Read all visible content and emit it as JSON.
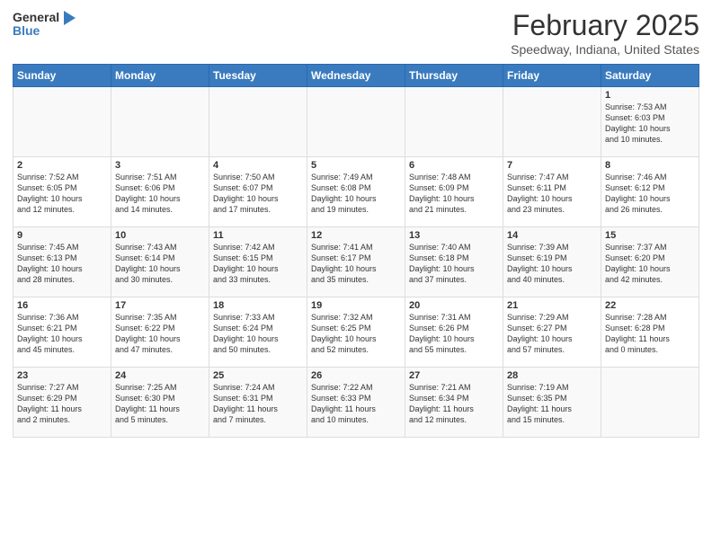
{
  "header": {
    "logo_general": "General",
    "logo_blue": "Blue",
    "title": "February 2025",
    "location": "Speedway, Indiana, United States"
  },
  "weekdays": [
    "Sunday",
    "Monday",
    "Tuesday",
    "Wednesday",
    "Thursday",
    "Friday",
    "Saturday"
  ],
  "weeks": [
    [
      {
        "day": "",
        "info": ""
      },
      {
        "day": "",
        "info": ""
      },
      {
        "day": "",
        "info": ""
      },
      {
        "day": "",
        "info": ""
      },
      {
        "day": "",
        "info": ""
      },
      {
        "day": "",
        "info": ""
      },
      {
        "day": "1",
        "info": "Sunrise: 7:53 AM\nSunset: 6:03 PM\nDaylight: 10 hours\nand 10 minutes."
      }
    ],
    [
      {
        "day": "2",
        "info": "Sunrise: 7:52 AM\nSunset: 6:05 PM\nDaylight: 10 hours\nand 12 minutes."
      },
      {
        "day": "3",
        "info": "Sunrise: 7:51 AM\nSunset: 6:06 PM\nDaylight: 10 hours\nand 14 minutes."
      },
      {
        "day": "4",
        "info": "Sunrise: 7:50 AM\nSunset: 6:07 PM\nDaylight: 10 hours\nand 17 minutes."
      },
      {
        "day": "5",
        "info": "Sunrise: 7:49 AM\nSunset: 6:08 PM\nDaylight: 10 hours\nand 19 minutes."
      },
      {
        "day": "6",
        "info": "Sunrise: 7:48 AM\nSunset: 6:09 PM\nDaylight: 10 hours\nand 21 minutes."
      },
      {
        "day": "7",
        "info": "Sunrise: 7:47 AM\nSunset: 6:11 PM\nDaylight: 10 hours\nand 23 minutes."
      },
      {
        "day": "8",
        "info": "Sunrise: 7:46 AM\nSunset: 6:12 PM\nDaylight: 10 hours\nand 26 minutes."
      }
    ],
    [
      {
        "day": "9",
        "info": "Sunrise: 7:45 AM\nSunset: 6:13 PM\nDaylight: 10 hours\nand 28 minutes."
      },
      {
        "day": "10",
        "info": "Sunrise: 7:43 AM\nSunset: 6:14 PM\nDaylight: 10 hours\nand 30 minutes."
      },
      {
        "day": "11",
        "info": "Sunrise: 7:42 AM\nSunset: 6:15 PM\nDaylight: 10 hours\nand 33 minutes."
      },
      {
        "day": "12",
        "info": "Sunrise: 7:41 AM\nSunset: 6:17 PM\nDaylight: 10 hours\nand 35 minutes."
      },
      {
        "day": "13",
        "info": "Sunrise: 7:40 AM\nSunset: 6:18 PM\nDaylight: 10 hours\nand 37 minutes."
      },
      {
        "day": "14",
        "info": "Sunrise: 7:39 AM\nSunset: 6:19 PM\nDaylight: 10 hours\nand 40 minutes."
      },
      {
        "day": "15",
        "info": "Sunrise: 7:37 AM\nSunset: 6:20 PM\nDaylight: 10 hours\nand 42 minutes."
      }
    ],
    [
      {
        "day": "16",
        "info": "Sunrise: 7:36 AM\nSunset: 6:21 PM\nDaylight: 10 hours\nand 45 minutes."
      },
      {
        "day": "17",
        "info": "Sunrise: 7:35 AM\nSunset: 6:22 PM\nDaylight: 10 hours\nand 47 minutes."
      },
      {
        "day": "18",
        "info": "Sunrise: 7:33 AM\nSunset: 6:24 PM\nDaylight: 10 hours\nand 50 minutes."
      },
      {
        "day": "19",
        "info": "Sunrise: 7:32 AM\nSunset: 6:25 PM\nDaylight: 10 hours\nand 52 minutes."
      },
      {
        "day": "20",
        "info": "Sunrise: 7:31 AM\nSunset: 6:26 PM\nDaylight: 10 hours\nand 55 minutes."
      },
      {
        "day": "21",
        "info": "Sunrise: 7:29 AM\nSunset: 6:27 PM\nDaylight: 10 hours\nand 57 minutes."
      },
      {
        "day": "22",
        "info": "Sunrise: 7:28 AM\nSunset: 6:28 PM\nDaylight: 11 hours\nand 0 minutes."
      }
    ],
    [
      {
        "day": "23",
        "info": "Sunrise: 7:27 AM\nSunset: 6:29 PM\nDaylight: 11 hours\nand 2 minutes."
      },
      {
        "day": "24",
        "info": "Sunrise: 7:25 AM\nSunset: 6:30 PM\nDaylight: 11 hours\nand 5 minutes."
      },
      {
        "day": "25",
        "info": "Sunrise: 7:24 AM\nSunset: 6:31 PM\nDaylight: 11 hours\nand 7 minutes."
      },
      {
        "day": "26",
        "info": "Sunrise: 7:22 AM\nSunset: 6:33 PM\nDaylight: 11 hours\nand 10 minutes."
      },
      {
        "day": "27",
        "info": "Sunrise: 7:21 AM\nSunset: 6:34 PM\nDaylight: 11 hours\nand 12 minutes."
      },
      {
        "day": "28",
        "info": "Sunrise: 7:19 AM\nSunset: 6:35 PM\nDaylight: 11 hours\nand 15 minutes."
      },
      {
        "day": "",
        "info": ""
      }
    ]
  ]
}
